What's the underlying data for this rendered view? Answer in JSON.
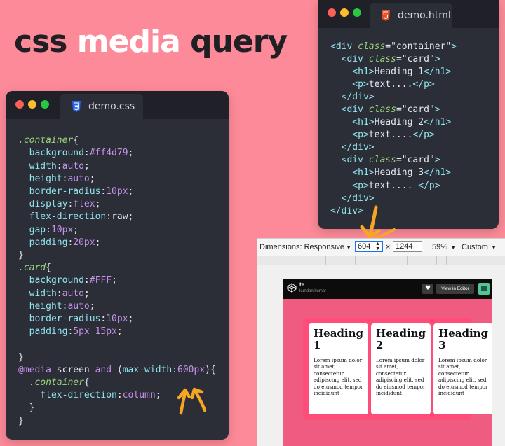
{
  "title": {
    "part1": "css",
    "part2": "media",
    "part3": "query"
  },
  "css_editor": {
    "filename": "demo.css",
    "lines": [
      [],
      [
        {
          "t": ".container",
          "c": "sel"
        },
        {
          "t": "{",
          "c": "punc"
        }
      ],
      [
        {
          "t": "  background",
          "c": "prop"
        },
        {
          "t": ":",
          "c": "punc"
        },
        {
          "t": "#ff4d79",
          "c": "val"
        },
        {
          "t": ";",
          "c": "punc"
        }
      ],
      [
        {
          "t": "  width",
          "c": "prop"
        },
        {
          "t": ":",
          "c": "punc"
        },
        {
          "t": "auto",
          "c": "val"
        },
        {
          "t": ";",
          "c": "punc"
        }
      ],
      [
        {
          "t": "  height",
          "c": "prop"
        },
        {
          "t": ":",
          "c": "punc"
        },
        {
          "t": "auto",
          "c": "val"
        },
        {
          "t": ";",
          "c": "punc"
        }
      ],
      [
        {
          "t": "  border-radius",
          "c": "prop"
        },
        {
          "t": ":",
          "c": "punc"
        },
        {
          "t": "10px",
          "c": "val"
        },
        {
          "t": ";",
          "c": "punc"
        }
      ],
      [
        {
          "t": "  display",
          "c": "prop"
        },
        {
          "t": ":",
          "c": "punc"
        },
        {
          "t": "flex",
          "c": "val"
        },
        {
          "t": ";",
          "c": "punc"
        }
      ],
      [
        {
          "t": "  flex-direction",
          "c": "prop"
        },
        {
          "t": ":",
          "c": "punc"
        },
        {
          "t": "raw",
          "c": "punc"
        },
        {
          "t": ";",
          "c": "punc"
        }
      ],
      [
        {
          "t": "  gap",
          "c": "prop"
        },
        {
          "t": ":",
          "c": "punc"
        },
        {
          "t": "10px",
          "c": "val"
        },
        {
          "t": ";",
          "c": "punc"
        }
      ],
      [
        {
          "t": "  padding",
          "c": "prop"
        },
        {
          "t": ":",
          "c": "punc"
        },
        {
          "t": "20px",
          "c": "val"
        },
        {
          "t": ";",
          "c": "punc"
        }
      ],
      [
        {
          "t": "}",
          "c": "punc"
        }
      ],
      [
        {
          "t": ".card",
          "c": "sel"
        },
        {
          "t": "{",
          "c": "punc"
        }
      ],
      [
        {
          "t": "  background",
          "c": "prop"
        },
        {
          "t": ":",
          "c": "punc"
        },
        {
          "t": "#FFF",
          "c": "val"
        },
        {
          "t": ";",
          "c": "punc"
        }
      ],
      [
        {
          "t": "  width",
          "c": "prop"
        },
        {
          "t": ":",
          "c": "punc"
        },
        {
          "t": "auto",
          "c": "val"
        },
        {
          "t": ";",
          "c": "punc"
        }
      ],
      [
        {
          "t": "  height",
          "c": "prop"
        },
        {
          "t": ":",
          "c": "punc"
        },
        {
          "t": "auto",
          "c": "val"
        },
        {
          "t": ";",
          "c": "punc"
        }
      ],
      [
        {
          "t": "  border-radius",
          "c": "prop"
        },
        {
          "t": ":",
          "c": "punc"
        },
        {
          "t": "10px",
          "c": "val"
        },
        {
          "t": ";",
          "c": "punc"
        }
      ],
      [
        {
          "t": "  padding",
          "c": "prop"
        },
        {
          "t": ":",
          "c": "punc"
        },
        {
          "t": "5px 15px",
          "c": "val"
        },
        {
          "t": ";",
          "c": "punc"
        }
      ],
      [],
      [
        {
          "t": "}",
          "c": "punc"
        }
      ],
      [
        {
          "t": "@media",
          "c": "media"
        },
        {
          "t": " screen ",
          "c": "punc"
        },
        {
          "t": "and",
          "c": "media"
        },
        {
          "t": " (",
          "c": "punc"
        },
        {
          "t": "max-width",
          "c": "prop"
        },
        {
          "t": ":",
          "c": "punc"
        },
        {
          "t": "600px",
          "c": "val"
        },
        {
          "t": "){",
          "c": "punc"
        }
      ],
      [
        {
          "t": "  .container",
          "c": "sel"
        },
        {
          "t": "{",
          "c": "punc"
        }
      ],
      [
        {
          "t": "    flex-direction",
          "c": "prop"
        },
        {
          "t": ":",
          "c": "punc"
        },
        {
          "t": "column",
          "c": "val"
        },
        {
          "t": ";",
          "c": "punc"
        }
      ],
      [
        {
          "t": "  }",
          "c": "punc"
        }
      ],
      [
        {
          "t": "}",
          "c": "punc"
        }
      ]
    ]
  },
  "html_editor": {
    "filename": "demo.html",
    "lines": [
      [
        {
          "t": "<div ",
          "c": "tag"
        },
        {
          "t": "class",
          "c": "attr"
        },
        {
          "t": "=\"container\"",
          "c": "str"
        },
        {
          "t": ">",
          "c": "tag"
        }
      ],
      [
        {
          "t": "  <div ",
          "c": "tag"
        },
        {
          "t": "class",
          "c": "attr"
        },
        {
          "t": "=\"card\"",
          "c": "str"
        },
        {
          "t": ">",
          "c": "tag"
        }
      ],
      [
        {
          "t": "    <h1>",
          "c": "tag"
        },
        {
          "t": "Heading 1",
          "c": "str"
        },
        {
          "t": "</h1>",
          "c": "tag"
        }
      ],
      [
        {
          "t": "    <p>",
          "c": "tag"
        },
        {
          "t": "text....",
          "c": "str"
        },
        {
          "t": "</p>",
          "c": "tag"
        }
      ],
      [
        {
          "t": "  </div>",
          "c": "tag"
        }
      ],
      [
        {
          "t": "  <div ",
          "c": "tag"
        },
        {
          "t": "class",
          "c": "attr"
        },
        {
          "t": "=\"card\"",
          "c": "str"
        },
        {
          "t": ">",
          "c": "tag"
        }
      ],
      [
        {
          "t": "    <h1>",
          "c": "tag"
        },
        {
          "t": "Heading 2",
          "c": "str"
        },
        {
          "t": "</h1>",
          "c": "tag"
        }
      ],
      [
        {
          "t": "    <p>",
          "c": "tag"
        },
        {
          "t": "text....",
          "c": "str"
        },
        {
          "t": "</p>",
          "c": "tag"
        }
      ],
      [
        {
          "t": "  </div>",
          "c": "tag"
        }
      ],
      [
        {
          "t": "  <div ",
          "c": "tag"
        },
        {
          "t": "class",
          "c": "attr"
        },
        {
          "t": "=\"card\"",
          "c": "str"
        },
        {
          "t": ">",
          "c": "tag"
        }
      ],
      [
        {
          "t": "    <h1>",
          "c": "tag"
        },
        {
          "t": "Heading 3",
          "c": "str"
        },
        {
          "t": "</h1>",
          "c": "tag"
        }
      ],
      [
        {
          "t": "    <p>",
          "c": "tag"
        },
        {
          "t": "text.... ",
          "c": "str"
        },
        {
          "t": "</p>",
          "c": "tag"
        }
      ],
      [
        {
          "t": "  </div>",
          "c": "tag"
        }
      ],
      [
        {
          "t": "</div>",
          "c": "tag"
        }
      ]
    ]
  },
  "devtools": {
    "dimensions_label": "Dimensions: Responsive",
    "width_value": "604",
    "times_symbol": "×",
    "height_value": "1244",
    "zoom": "59%",
    "throttle": "Custom"
  },
  "preview": {
    "pen_title": "te",
    "pen_author": "kundan kumar",
    "view_editor": "View in Editor",
    "cards": [
      {
        "heading": "Heading 1",
        "text": "Lorem ipsum dolor sit amet, consectetur adipiscing elit, sed do eiusmod tempor incididunt"
      },
      {
        "heading": "Heading 2",
        "text": "Lorem ipsum dolor sit amet, consectetur adipiscing elit, sed do eiusmod tempor incididunt"
      },
      {
        "heading": "Heading 3",
        "text": "Lorem ipsum dolor sit amet, consectetur adipiscing elit, sed do eiusmod tempor incididunt"
      }
    ]
  },
  "colors": {
    "background": "#fd8a98",
    "editor_bg": "#2b2d37",
    "container_pink": "#ff4d79",
    "arrow_orange": "#f6a623"
  }
}
